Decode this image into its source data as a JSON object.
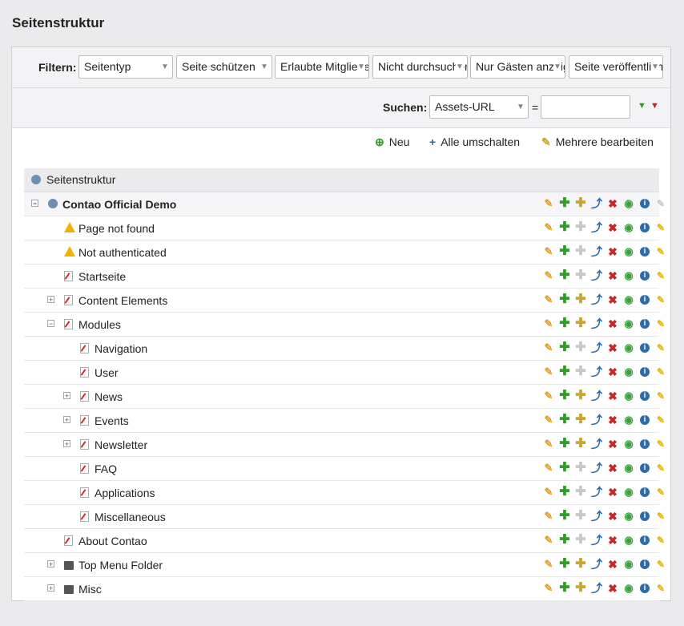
{
  "page": {
    "title": "Seitenstruktur"
  },
  "filter": {
    "label": "Filtern:",
    "selects": [
      {
        "name": "filter-seitentyp",
        "value": "Seitentyp"
      },
      {
        "name": "filter-seite-schuetzen",
        "value": "Seite schützen"
      },
      {
        "name": "filter-erlaubte-mitglieder",
        "value": "Erlaubte Mitglieder"
      },
      {
        "name": "filter-nicht-durchsuchen",
        "value": "Nicht durchsuchen"
      },
      {
        "name": "filter-nur-gaesten-anzeigen",
        "value": "Nur Gästen anzeigen"
      },
      {
        "name": "filter-seite-veroeffentlichen",
        "value": "Seite veröffentlichen"
      }
    ]
  },
  "search": {
    "label": "Suchen:",
    "field": "Assets-URL",
    "equals": "=",
    "value": ""
  },
  "actions": {
    "new": "Neu",
    "toggle_all": "Alle umschalten",
    "edit_multiple": "Mehrere bearbeiten"
  },
  "tree": {
    "header": "Seitenstruktur",
    "rows": [
      {
        "label": "Contao Official Demo",
        "depth": 0,
        "toggle": "minus",
        "icon": "root",
        "root": true,
        "paste_child": true,
        "article": false
      },
      {
        "label": "Page not found",
        "depth": 1,
        "toggle": "",
        "icon": "warn",
        "paste_child": false,
        "article": true
      },
      {
        "label": "Not authenticated",
        "depth": 1,
        "toggle": "",
        "icon": "warn",
        "paste_child": false,
        "article": true
      },
      {
        "label": "Startseite",
        "depth": 1,
        "toggle": "",
        "icon": "page",
        "paste_child": false,
        "article": true
      },
      {
        "label": "Content Elements",
        "depth": 1,
        "toggle": "plus",
        "icon": "page",
        "paste_child": true,
        "article": true
      },
      {
        "label": "Modules",
        "depth": 1,
        "toggle": "minus",
        "icon": "page",
        "paste_child": true,
        "article": true
      },
      {
        "label": "Navigation",
        "depth": 2,
        "toggle": "",
        "icon": "page",
        "paste_child": false,
        "article": true
      },
      {
        "label": "User",
        "depth": 2,
        "toggle": "",
        "icon": "page",
        "paste_child": false,
        "article": true
      },
      {
        "label": "News",
        "depth": 2,
        "toggle": "plus",
        "icon": "page",
        "paste_child": true,
        "article": true
      },
      {
        "label": "Events",
        "depth": 2,
        "toggle": "plus",
        "icon": "page",
        "paste_child": true,
        "article": true
      },
      {
        "label": "Newsletter",
        "depth": 2,
        "toggle": "plus",
        "icon": "page",
        "paste_child": true,
        "article": true
      },
      {
        "label": "FAQ",
        "depth": 2,
        "toggle": "",
        "icon": "page",
        "paste_child": false,
        "article": true
      },
      {
        "label": "Applications",
        "depth": 2,
        "toggle": "",
        "icon": "page",
        "paste_child": false,
        "article": true
      },
      {
        "label": "Miscellaneous",
        "depth": 2,
        "toggle": "",
        "icon": "page",
        "paste_child": false,
        "article": true
      },
      {
        "label": "About Contao",
        "depth": 1,
        "toggle": "",
        "icon": "page",
        "paste_child": false,
        "article": true
      },
      {
        "label": "Top Menu Folder",
        "depth": 1,
        "toggle": "plus",
        "icon": "folder",
        "paste_child": true,
        "article": true
      },
      {
        "label": "Misc",
        "depth": 1,
        "toggle": "plus",
        "icon": "folder",
        "paste_child": true,
        "article": true
      }
    ]
  },
  "icons": {
    "edit": "pencil-icon",
    "copy": "plus-icon",
    "copy_child": "paste-child-icon",
    "cut": "move-icon",
    "delete": "delete-icon",
    "toggle_visibility": "eye-icon",
    "info": "info-icon",
    "article": "article-icon"
  },
  "colors": {
    "accent_green": "#2f9e28",
    "delete_red": "#c62828",
    "link_blue": "#2c6aa8",
    "warn_yellow": "#f0b400"
  }
}
